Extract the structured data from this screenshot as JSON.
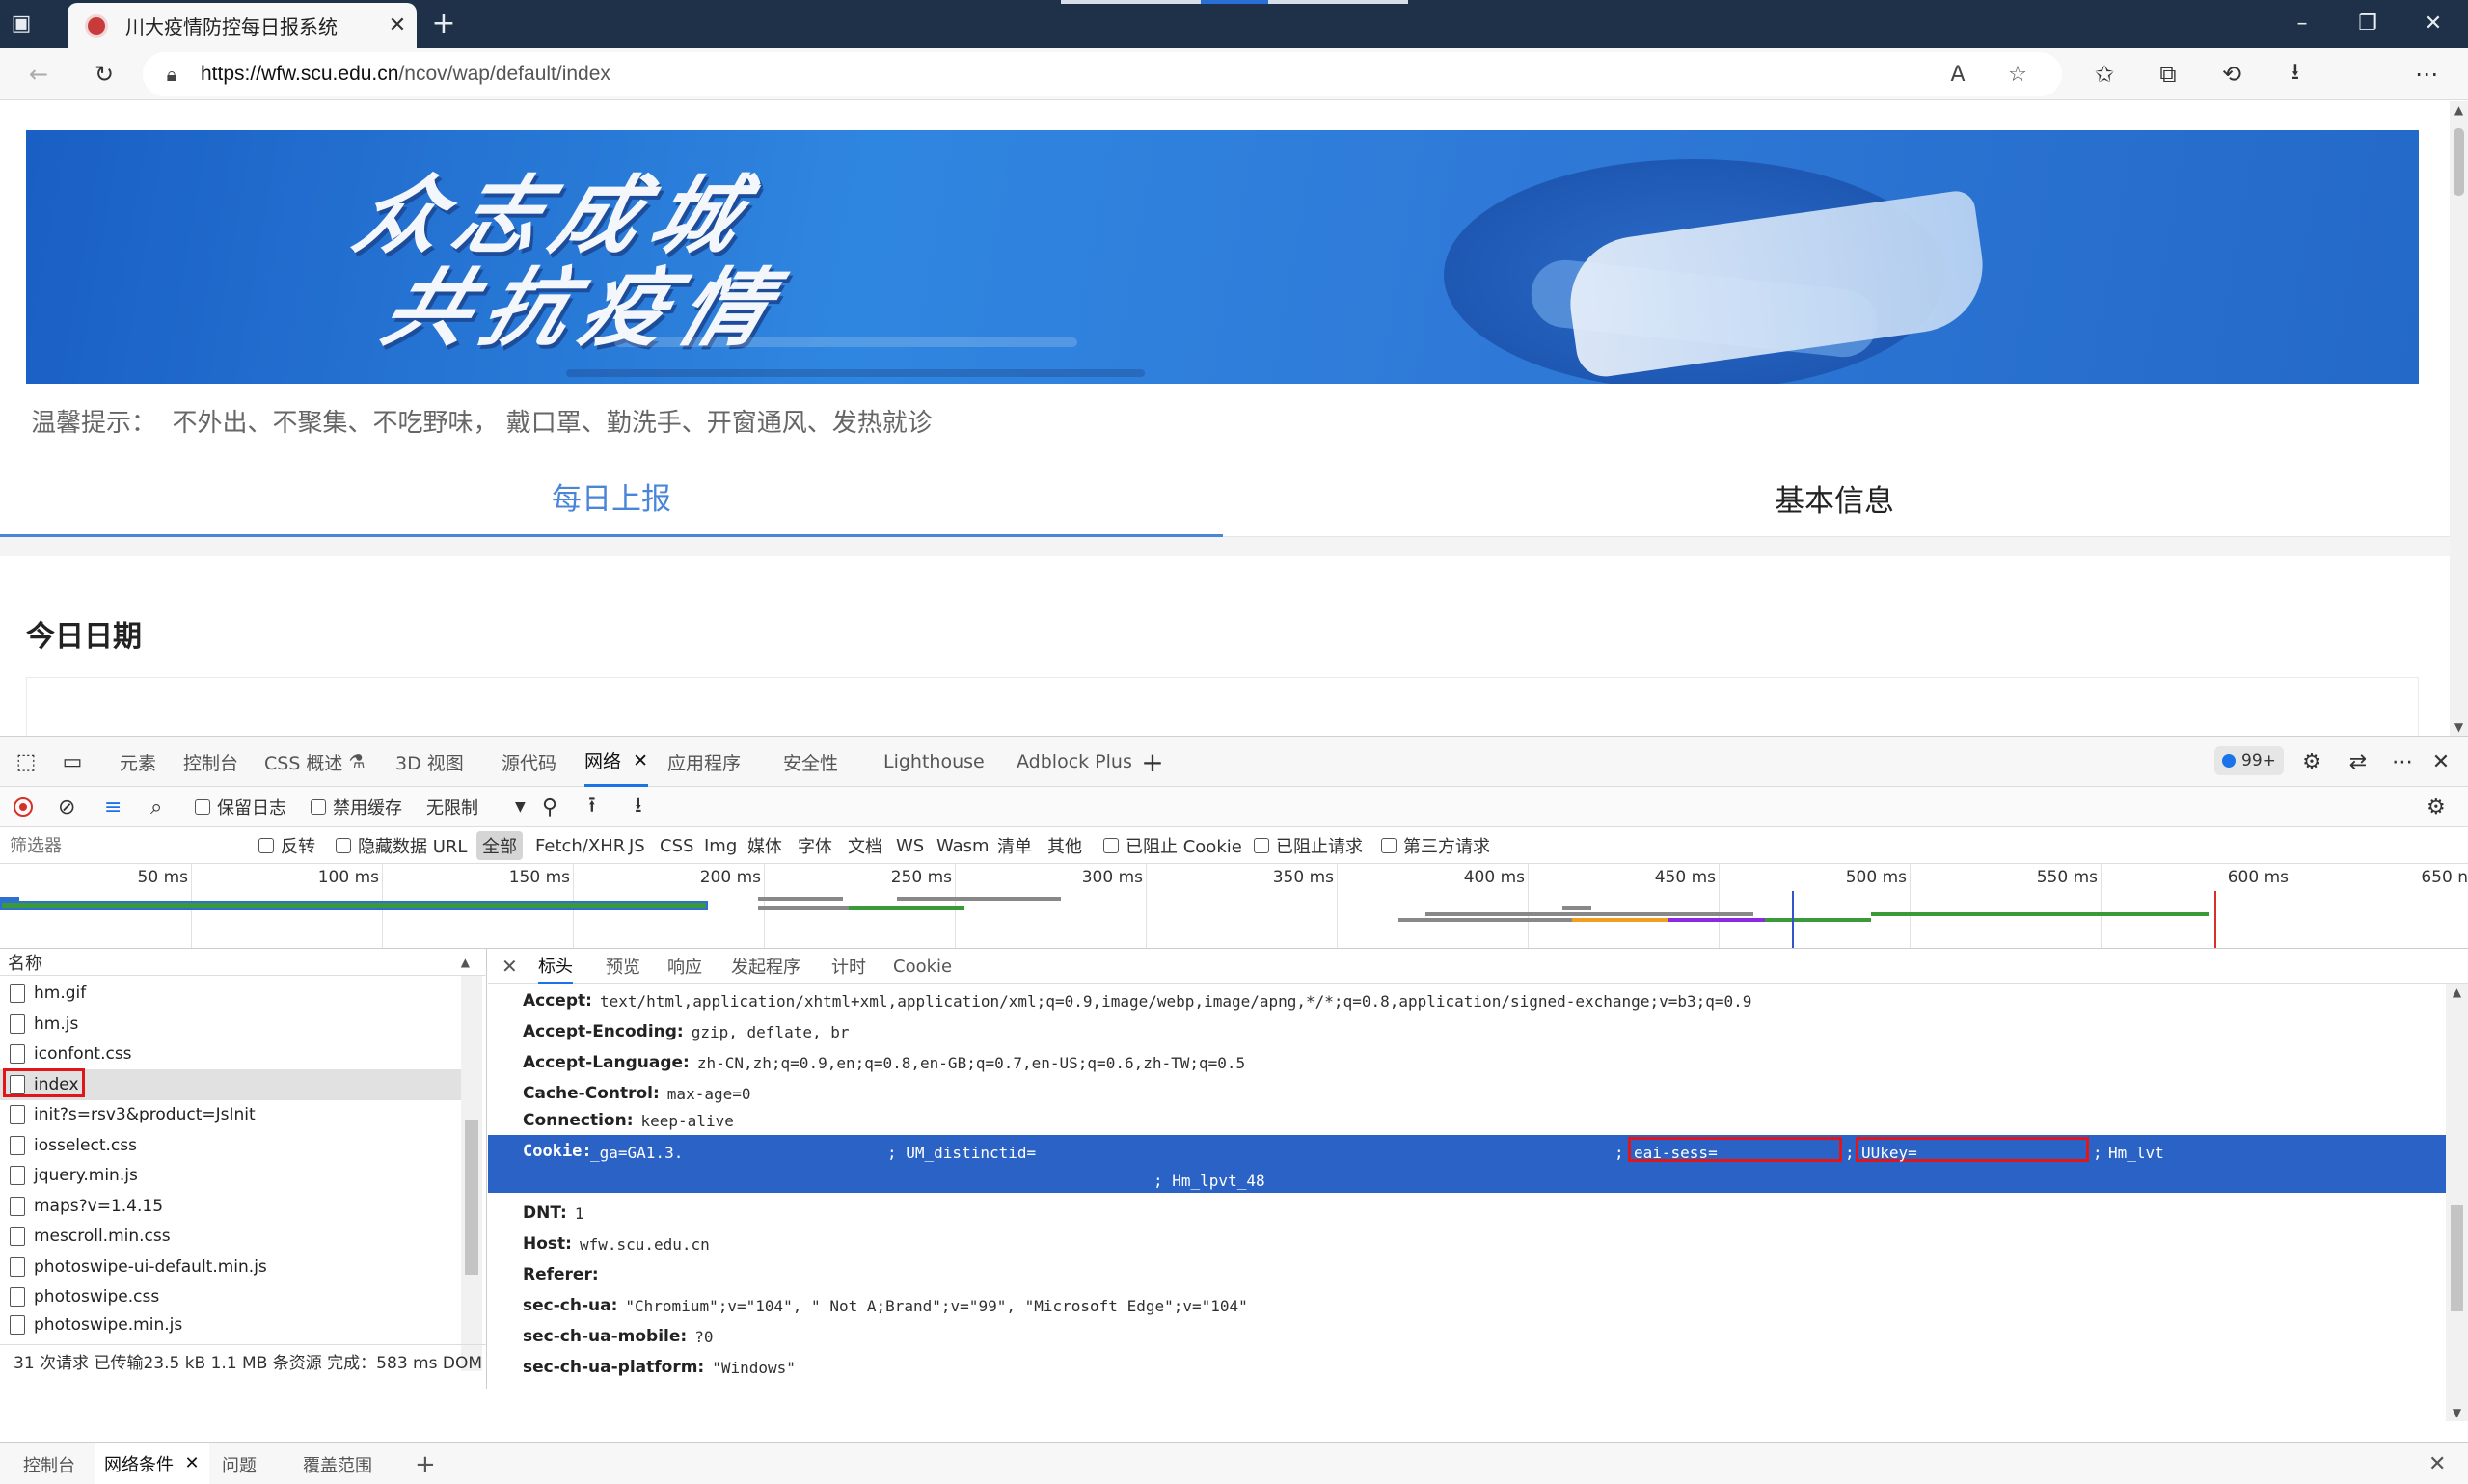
{
  "browser": {
    "tab_title": "川大疫情防控每日报系统",
    "tab_close": "✕",
    "new_tab": "+",
    "url_host": "https://wfw.scu.edu.cn",
    "url_path": "/ncov/wap/default/index",
    "window": {
      "minimize": "–",
      "restore": "❐",
      "close": "✕"
    },
    "icons": {
      "sidebar": "sidebar-icon",
      "back": "back-icon",
      "refresh": "refresh-icon",
      "lock": "lock-icon",
      "read_aloud": "read-aloud-icon",
      "add_favorite": "add-favorite-icon",
      "favorites": "favorites-icon",
      "collections": "collections-icon",
      "history": "history-icon",
      "downloads": "downloads-icon",
      "more": "more-icon"
    }
  },
  "page": {
    "banner_line1": "众志成城",
    "banner_line2": "共抗疫情",
    "tip": "温馨提示：  不外出、不聚集、不吃野味， 戴口罩、勤洗手、开窗通风、发热就诊",
    "tab_daily": "每日上报",
    "tab_basic": "基本信息",
    "today_title": "今日日期"
  },
  "devtools": {
    "tabs": [
      "元素",
      "控制台",
      "CSS 概述",
      "3D 视图",
      "源代码",
      "网络",
      "应用程序",
      "安全性",
      "Lighthouse",
      "Adblock Plus"
    ],
    "active_tab": "网络",
    "issues_count": "99+",
    "net_toolbar": {
      "preserve_log": "保留日志",
      "disable_cache": "禁用缓存",
      "throttling": "无限制"
    },
    "filter": {
      "placeholder": "筛选器",
      "invert": "反转",
      "hide_data_url": "隐藏数据 URL",
      "types": [
        "全部",
        "Fetch/XHR",
        "JS",
        "CSS",
        "Img",
        "媒体",
        "字体",
        "文档",
        "WS",
        "Wasm",
        "清单",
        "其他"
      ],
      "blocked_cookies": "已阻止 Cookie",
      "blocked_requests": "已阻止请求",
      "third_party": "第三方请求"
    },
    "timeline_ticks": [
      "50 ms",
      "100 ms",
      "150 ms",
      "200 ms",
      "250 ms",
      "300 ms",
      "350 ms",
      "400 ms",
      "450 ms",
      "500 ms",
      "550 ms",
      "600 ms",
      "650 n"
    ],
    "request_list": {
      "header": "名称",
      "rows": [
        "hm.gif",
        "hm.js",
        "iconfont.css",
        "index",
        "init?s=rsv3&product=JsInit",
        "iosselect.css",
        "jquery.min.js",
        "maps?v=1.4.15",
        "mescroll.min.css",
        "photoswipe-ui-default.min.js",
        "photoswipe.css",
        "photoswipe.min.js"
      ],
      "selected": "index",
      "status": "31 次请求  已传输23.5 kB  1.1 MB 条资源  完成：583 ms  DOM"
    },
    "details": {
      "tabs": [
        "标头",
        "预览",
        "响应",
        "发起程序",
        "计时",
        "Cookie"
      ],
      "active_tab": "标头",
      "headers": [
        {
          "k": "Accept:",
          "v": "text/html,application/xhtml+xml,application/xml;q=0.9,image/webp,image/apng,*/*;q=0.8,application/signed-exchange;v=b3;q=0.9"
        },
        {
          "k": "Accept-Encoding:",
          "v": "gzip, deflate, br"
        },
        {
          "k": "Accept-Language:",
          "v": "zh-CN,zh;q=0.9,en;q=0.8,en-GB;q=0.7,en-US;q=0.6,zh-TW;q=0.5"
        },
        {
          "k": "Cache-Control:",
          "v": "max-age=0"
        },
        {
          "k": "Connection:",
          "v": "keep-alive"
        }
      ],
      "cookie": {
        "k": "Cookie:",
        "ga": "_ga=GA1.3.",
        "um": "; UM_distinctid=",
        "eai": "eai-sess=",
        "sep1": ";",
        "uukey": "UUkey=",
        "sep2": ";",
        "hm_lvt": "Hm_lvt",
        "hm_lpvt": "; Hm_lpvt_48"
      },
      "headers_after": [
        {
          "k": "DNT:",
          "v": "1"
        },
        {
          "k": "Host:",
          "v": "wfw.scu.edu.cn"
        },
        {
          "k": "Referer:",
          "v": ""
        },
        {
          "k": "sec-ch-ua:",
          "v": "\"Chromium\";v=\"104\", \" Not A;Brand\";v=\"99\", \"Microsoft Edge\";v=\"104\""
        },
        {
          "k": "sec-ch-ua-mobile:",
          "v": "?0"
        },
        {
          "k": "sec-ch-ua-platform:",
          "v": "\"Windows\""
        }
      ]
    },
    "drawer_tabs": [
      "控制台",
      "网络条件",
      "问题",
      "覆盖范围"
    ],
    "drawer_active": "网络条件"
  }
}
